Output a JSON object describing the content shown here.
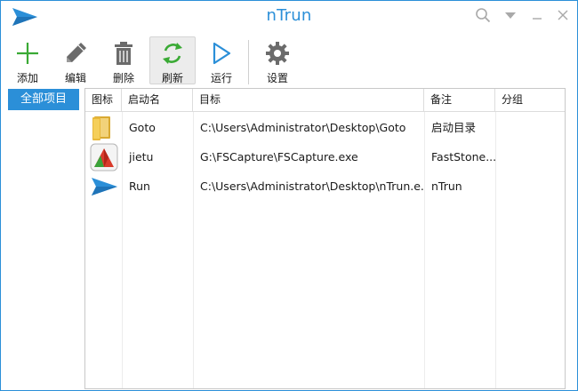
{
  "window": {
    "title": "nTrun",
    "accent": "#2b8fd8"
  },
  "titlebar": {
    "icons": [
      "search-icon",
      "dropdown-arrow-icon",
      "minimize-icon",
      "close-icon"
    ]
  },
  "toolbar": {
    "add": "添加",
    "edit": "编辑",
    "delete": "删除",
    "refresh": "刷新",
    "run": "运行",
    "settings": "设置"
  },
  "sidebar": {
    "groups": [
      {
        "label": "全部项目",
        "selected": true
      }
    ]
  },
  "list": {
    "columns": [
      "图标",
      "启动名",
      "目标",
      "备注",
      "分组"
    ],
    "rows": [
      {
        "icon": "folder-icon",
        "name": "Goto",
        "target": "C:\\Users\\Administrator\\Desktop\\Goto",
        "note": "启动目录",
        "group": ""
      },
      {
        "icon": "fscapture-icon",
        "name": "jietu",
        "target": "G:\\FSCapture\\FSCapture.exe",
        "note": "FastStone...",
        "group": ""
      },
      {
        "icon": "paper-plane-icon",
        "name": "Run",
        "target": "C:\\Users\\Administrator\\Desktop\\nTrun.e...",
        "note": "nTrun",
        "group": ""
      }
    ]
  }
}
